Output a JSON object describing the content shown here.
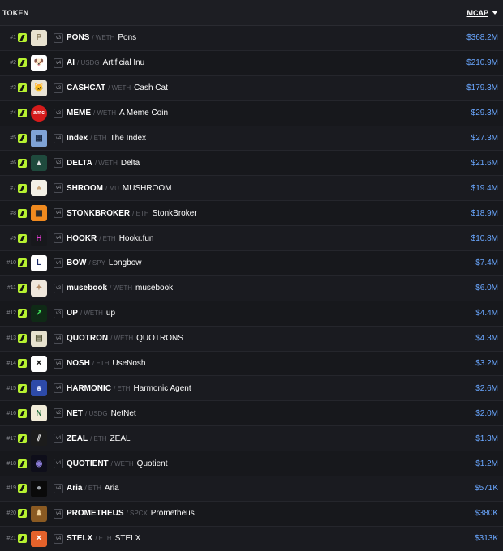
{
  "header": {
    "token_label": "TOKEN",
    "mcap_label": "MCAP"
  },
  "colors": {
    "accent": "#b7f231",
    "mcap": "#6aa7ff",
    "background": "#17181c"
  },
  "rows": [
    {
      "rank": "#1",
      "version": "v3",
      "symbol": "PONS",
      "pair": "/ WETH",
      "name": "Pons",
      "mcap": "$368.2M",
      "avatar_bg": "#e8e2d0",
      "avatar_text": "P",
      "avatar_color": "#8c7e60"
    },
    {
      "rank": "#2",
      "version": "v4",
      "symbol": "AI",
      "pair": "/ USDG",
      "name": "Artificial Inu",
      "mcap": "$210.9M",
      "avatar_bg": "#ffffff",
      "avatar_text": "🐶",
      "avatar_color": "#000"
    },
    {
      "rank": "#3",
      "version": "v3",
      "symbol": "CASHCAT",
      "pair": "/ WETH",
      "name": "Cash Cat",
      "mcap": "$179.3M",
      "avatar_bg": "#e9e3d6",
      "avatar_text": "🐱",
      "avatar_color": "#000"
    },
    {
      "rank": "#4",
      "version": "v3",
      "symbol": "MEME",
      "pair": "/ WETH",
      "name": "A Meme Coin",
      "mcap": "$29.3M",
      "avatar_bg": "#d61b1b",
      "avatar_text": "amc",
      "avatar_color": "#ffffff"
    },
    {
      "rank": "#5",
      "version": "v4",
      "symbol": "Index",
      "pair": "/ ETH",
      "name": "The Index",
      "mcap": "$27.3M",
      "avatar_bg": "#7fa3d6",
      "avatar_text": "▦",
      "avatar_color": "#1a2a44"
    },
    {
      "rank": "#6",
      "version": "v3",
      "symbol": "DELTA",
      "pair": "/ WETH",
      "name": "Delta",
      "mcap": "$21.6M",
      "avatar_bg": "#1f4a3d",
      "avatar_text": "▲",
      "avatar_color": "#e0e0e0"
    },
    {
      "rank": "#7",
      "version": "v4",
      "symbol": "SHROOM",
      "pair": "/ MU",
      "name": "MUSHROOM",
      "mcap": "$19.4M",
      "avatar_bg": "#f3f0e6",
      "avatar_text": "♠",
      "avatar_color": "#c9a67a"
    },
    {
      "rank": "#8",
      "version": "v4",
      "symbol": "STONKBROKER",
      "pair": "/ ETH",
      "name": "StonkBroker",
      "mcap": "$18.9M",
      "avatar_bg": "#f08a1f",
      "avatar_text": "▣",
      "avatar_color": "#2b2b2b"
    },
    {
      "rank": "#9",
      "version": "v4",
      "symbol": "HOOKR",
      "pair": "/ ETH",
      "name": "Hookr.fun",
      "mcap": "$10.8M",
      "avatar_bg": "#17181c",
      "avatar_text": "H",
      "avatar_color": "#e23ad1"
    },
    {
      "rank": "#10",
      "version": "v4",
      "symbol": "BOW",
      "pair": "/ SPY",
      "name": "Longbow",
      "mcap": "$7.4M",
      "avatar_bg": "#ffffff",
      "avatar_text": "L",
      "avatar_color": "#1a2a66"
    },
    {
      "rank": "#11",
      "version": "v3",
      "symbol": "musebook",
      "pair": "/ WETH",
      "name": "musebook",
      "mcap": "$6.0M",
      "avatar_bg": "#efe7dc",
      "avatar_text": "✦",
      "avatar_color": "#b58f6a"
    },
    {
      "rank": "#12",
      "version": "v3",
      "symbol": "UP",
      "pair": "/ WETH",
      "name": "up",
      "mcap": "$4.4M",
      "avatar_bg": "#0f2a16",
      "avatar_text": "↗",
      "avatar_color": "#41e05a"
    },
    {
      "rank": "#13",
      "version": "v4",
      "symbol": "QUOTRON",
      "pair": "/ WETH",
      "name": "QUOTRONS",
      "mcap": "$4.3M",
      "avatar_bg": "#e7e2cf",
      "avatar_text": "▤",
      "avatar_color": "#5a5a3c"
    },
    {
      "rank": "#14",
      "version": "v4",
      "symbol": "NOSH",
      "pair": "/ ETH",
      "name": "UseNosh",
      "mcap": "$3.2M",
      "avatar_bg": "#ffffff",
      "avatar_text": "✕",
      "avatar_color": "#1a1a1a"
    },
    {
      "rank": "#15",
      "version": "v4",
      "symbol": "HARMONIC",
      "pair": "/ ETH",
      "name": "Harmonic Agent",
      "mcap": "$2.6M",
      "avatar_bg": "#2d4aa8",
      "avatar_text": "☻",
      "avatar_color": "#dfe6ff"
    },
    {
      "rank": "#16",
      "version": "v2",
      "symbol": "NET",
      "pair": "/ USDG",
      "name": "NetNet",
      "mcap": "$2.0M",
      "avatar_bg": "#f1ecd9",
      "avatar_text": "N",
      "avatar_color": "#1e6b3a"
    },
    {
      "rank": "#17",
      "version": "v4",
      "symbol": "ZEAL",
      "pair": "/ ETH",
      "name": "ZEAL",
      "mcap": "$1.3M",
      "avatar_bg": "#1c1c1c",
      "avatar_text": "⫽",
      "avatar_color": "#e6e6e6"
    },
    {
      "rank": "#18",
      "version": "v4",
      "symbol": "QUOTIENT",
      "pair": "/ WETH",
      "name": "Quotient",
      "mcap": "$1.2M",
      "avatar_bg": "#0e0e1a",
      "avatar_text": "◉",
      "avatar_color": "#8a7bd6"
    },
    {
      "rank": "#19",
      "version": "v4",
      "symbol": "Aria",
      "pair": "/ ETH",
      "name": "Aria",
      "mcap": "$571K",
      "avatar_bg": "#0a0a0a",
      "avatar_text": "●",
      "avatar_color": "#9aa0a6"
    },
    {
      "rank": "#20",
      "version": "v4",
      "symbol": "PROMETHEUS",
      "pair": "/ SPCX",
      "name": "Prometheus",
      "mcap": "$380K",
      "avatar_bg": "#8a5a22",
      "avatar_text": "♟",
      "avatar_color": "#f2d39a"
    },
    {
      "rank": "#21",
      "version": "v4",
      "symbol": "STELX",
      "pair": "/ ETH",
      "name": "STELX",
      "mcap": "$313K",
      "avatar_bg": "#e4622b",
      "avatar_text": "✕",
      "avatar_color": "#ffffff"
    }
  ]
}
